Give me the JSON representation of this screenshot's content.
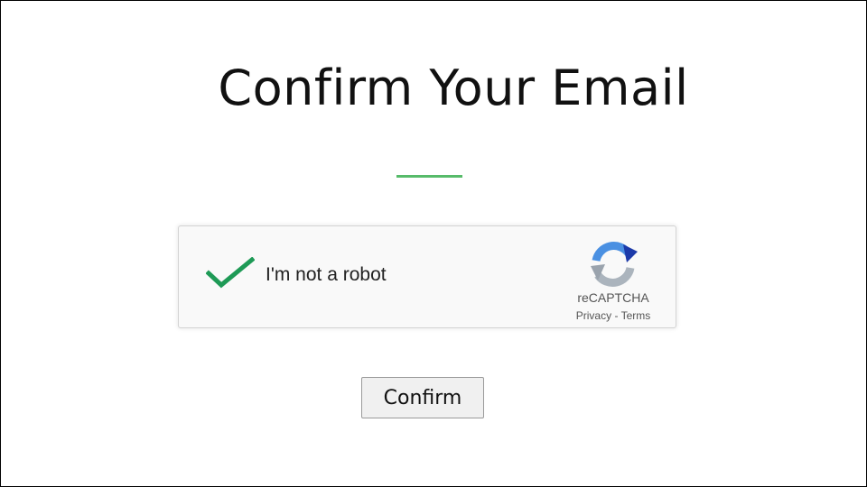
{
  "page": {
    "title": "Confirm Your Email",
    "accent_color": "#57bb6a"
  },
  "captcha": {
    "checked": true,
    "checkmark_color": "#1e9a56",
    "checkmark_icon": "check-icon",
    "label": "I'm not a robot",
    "logo_icon": "recaptcha-logo-icon",
    "brand": "reCAPTCHA",
    "privacy_link": "Privacy",
    "separator": " - ",
    "terms_link": "Terms"
  },
  "actions": {
    "confirm_label": "Confirm"
  }
}
